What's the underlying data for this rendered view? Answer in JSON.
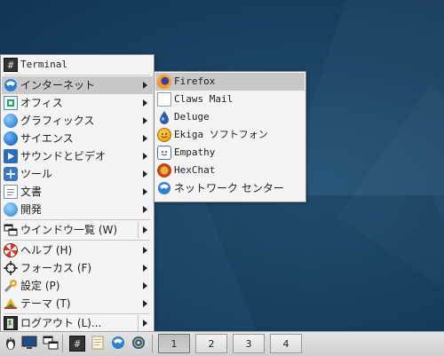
{
  "main_menu": {
    "items": [
      {
        "id": "terminal",
        "label": "Terminal",
        "icon": "terminal-icon"
      },
      {
        "id": "internet",
        "label": "インターネット",
        "icon": "internet-icon"
      },
      {
        "id": "office",
        "label": "オフィス",
        "icon": "office-icon"
      },
      {
        "id": "graphics",
        "label": "グラフィックス",
        "icon": "graphics-icon"
      },
      {
        "id": "science",
        "label": "サイエンス",
        "icon": "science-icon"
      },
      {
        "id": "sound-video",
        "label": "サウンドとビデオ",
        "icon": "sound-video-icon"
      },
      {
        "id": "tools",
        "label": "ツール",
        "icon": "tools-icon"
      },
      {
        "id": "documents",
        "label": "文書",
        "icon": "documents-icon"
      },
      {
        "id": "development",
        "label": "開発",
        "icon": "development-icon"
      },
      {
        "id": "window-list",
        "label": "ウインドウ一覧 (W)",
        "icon": "window-list-icon"
      },
      {
        "id": "help",
        "label": "ヘルプ (H)",
        "icon": "help-icon"
      },
      {
        "id": "focus",
        "label": "フォーカス (F)",
        "icon": "focus-icon"
      },
      {
        "id": "settings",
        "label": "設定 (P)",
        "icon": "settings-icon"
      },
      {
        "id": "theme",
        "label": "テーマ (T)",
        "icon": "theme-icon"
      },
      {
        "id": "logout",
        "label": "ログアウト (L)...",
        "icon": "logout-icon"
      }
    ],
    "highlighted": "インターネット"
  },
  "internet_submenu": {
    "items": [
      {
        "label": "Firefox",
        "icon": "firefox-icon"
      },
      {
        "label": "Claws Mail",
        "icon": "claws-mail-icon"
      },
      {
        "label": "Deluge",
        "icon": "deluge-icon"
      },
      {
        "label": "Ekiga ソフトフォン",
        "icon": "ekiga-icon"
      },
      {
        "label": "Empathy",
        "icon": "empathy-icon"
      },
      {
        "label": "HexChat",
        "icon": "hexchat-icon"
      },
      {
        "label": "ネットワーク センター",
        "icon": "network-center-icon"
      }
    ],
    "highlighted": "Firefox"
  },
  "taskbar": {
    "launchers": [
      "root-menu-icon",
      "desktop-icon",
      "window-list-icon",
      "terminal-icon",
      "text-editor-icon",
      "network-icon",
      "browser-icon"
    ],
    "workspaces": [
      "1",
      "2",
      "3",
      "4"
    ],
    "active_workspace": "1"
  },
  "colors": {
    "desktop": "#1b4466",
    "menu_bg": "#f4f4f4",
    "highlight": "#c8c8c8"
  }
}
